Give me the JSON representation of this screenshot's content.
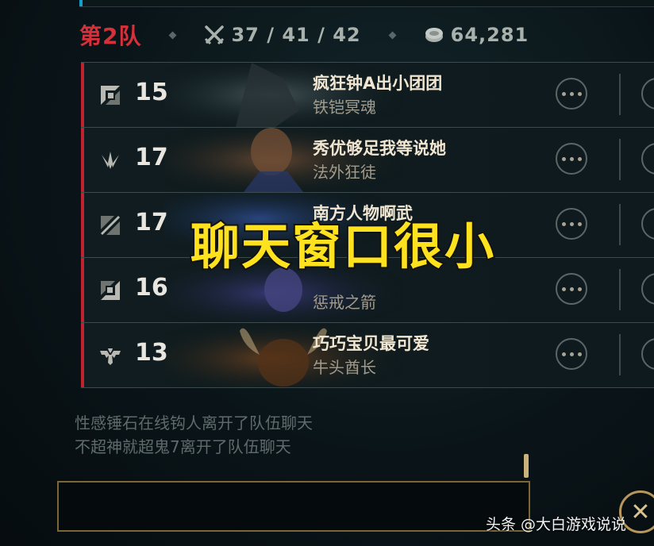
{
  "team": {
    "name": "第2队",
    "kda": "37 / 41 / 42",
    "gold": "64,281"
  },
  "players": [
    {
      "role_icon": "top-lane-icon",
      "level": "15",
      "name": "疯狂钟A出小团团",
      "champion": "铁铠冥魂"
    },
    {
      "role_icon": "jungle-icon",
      "level": "17",
      "name": "秀优够足我等说她",
      "champion": "法外狂徒"
    },
    {
      "role_icon": "mid-lane-icon",
      "level": "17",
      "name": "南方人物啊武",
      "champion": ""
    },
    {
      "role_icon": "bot-lane-icon",
      "level": "16",
      "name": "",
      "champion": "惩戒之箭"
    },
    {
      "role_icon": "support-icon",
      "level": "13",
      "name": "巧巧宝贝最可爱",
      "champion": "牛头酋长"
    }
  ],
  "overlay_caption": "聊天窗口很小",
  "chat": {
    "messages": [
      "性感锤石在线钩人离开了队伍聊天",
      "不超神就超鬼7离开了队伍聊天"
    ],
    "input_value": ""
  },
  "close_label": "✕",
  "watermark": "头条 @大白游戏说说",
  "colors": {
    "team_red": "#d6303a",
    "gold_border": "#b8975a",
    "caption_yellow": "#ffe21e"
  }
}
